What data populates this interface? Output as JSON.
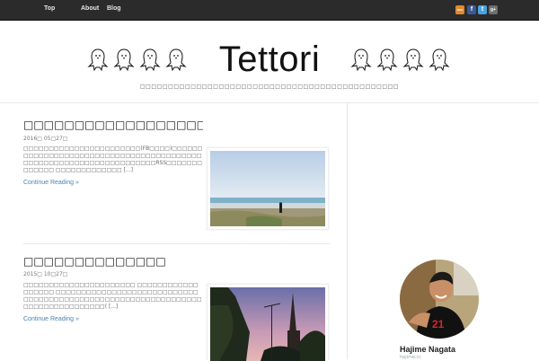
{
  "nav": {
    "items": [
      "Top",
      "About",
      "Blog"
    ]
  },
  "social": {
    "rss_label": "RSS",
    "facebook_label": "f",
    "twitter_label": "t",
    "googleplus_label": "g+",
    "colors": {
      "rss": "#e08a2e",
      "facebook": "#3b5998",
      "twitter": "#4aa3df",
      "googleplus": "#6f6f6f"
    }
  },
  "header": {
    "title": "Tettori",
    "tagline": "□□□□□□□□□□□□□□□□□□□□□□□□□□□□□□□□□□□□□□□□□□□□□□"
  },
  "posts": [
    {
      "title": "□□□□□□□□□□□□□□□□□□□□□□",
      "date": "2016□ 05□27□",
      "excerpt": "□□□□□□□□□□□□□□□□□□□□□□□(FB□□□□)□□□□□□□□□□□□□□□□□□□□□□□□□□□□□□□□□□□□□□□□□□□□□□□□□□□□□□□□□□□□□□□□□□□RSS□□□□□□□□□□□□□ □□□□□□□□□□□□□ [...]",
      "continue": "Continue Reading »"
    },
    {
      "title": "□□□□□□□□□□□□□□",
      "date": "2015□ 10□27□",
      "excerpt": "□□□□□□□□□□□□□□□□□□□□□□ □□□□□□□□□□□□□□□□□□ □□□□□□□□□□□□□□□□□□□□□□□□□□□□□□□□□□□□□□□□□□□□□□□□□□□□□□□□□□□□□□□□□□□□□□□□□□□□□□□( [...]",
      "continue": "Continue Reading »"
    }
  ],
  "author": {
    "name": "Hajime Nagata",
    "subtitle": "hajime.cc"
  }
}
